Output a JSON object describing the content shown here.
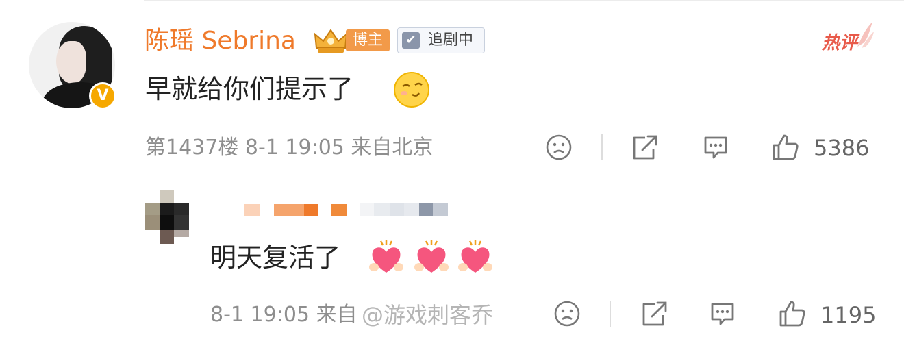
{
  "main_comment": {
    "username": "陈瑶 Sebrina",
    "badge_label": "博主",
    "tag_label": "追剧中",
    "hot_label": "热评",
    "text": "早就给你们提示了",
    "floor_time": "第1437楼 8-1 19:05 来自北京",
    "likes": "5386"
  },
  "reply": {
    "text": "明天复活了",
    "time_prefix": "8-1 19:05 来自",
    "likes": "1195"
  },
  "watermark": "@游戏刺客乔",
  "colors": {
    "username": "#ef7a2b",
    "badge": "#f29a49",
    "hot": "#e85a4a",
    "meta": "#8e8e8e"
  }
}
